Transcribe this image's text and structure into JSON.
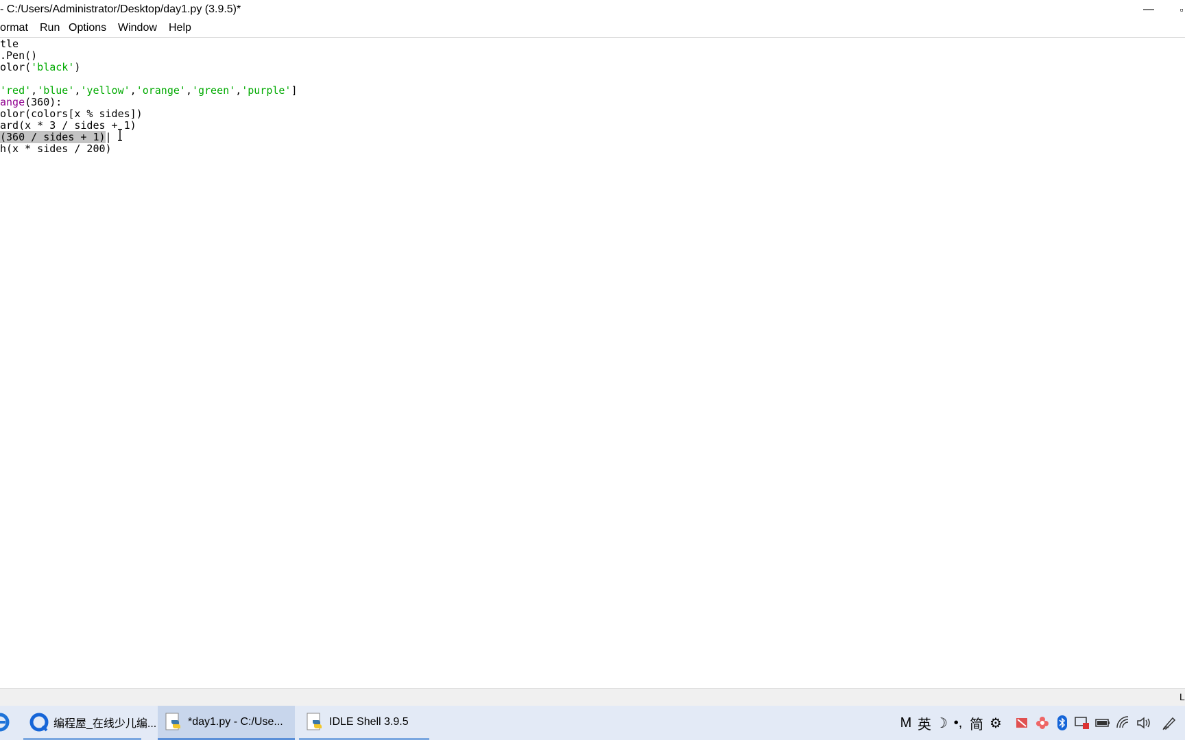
{
  "window": {
    "title": "- C:/Users/Administrator/Desktop/day1.py (3.9.5)*",
    "minimize_glyph": "—",
    "maximize_glyph": "▫"
  },
  "menubar": {
    "items": [
      {
        "label": "ormat"
      },
      {
        "label": "Run"
      },
      {
        "label": "Options"
      },
      {
        "label": "Window"
      },
      {
        "label": "Help"
      }
    ]
  },
  "editor": {
    "lines": [
      {
        "segments": [
          {
            "text": "tle",
            "kind": "plain"
          }
        ]
      },
      {
        "segments": [
          {
            "text": ".Pen()",
            "kind": "plain"
          }
        ]
      },
      {
        "segments": [
          {
            "text": "olor(",
            "kind": "plain"
          },
          {
            "text": "'black'",
            "kind": "str"
          },
          {
            "text": ")",
            "kind": "plain"
          }
        ]
      },
      {
        "segments": []
      },
      {
        "segments": [
          {
            "text": "'red'",
            "kind": "str"
          },
          {
            "text": ",",
            "kind": "plain"
          },
          {
            "text": "'blue'",
            "kind": "str"
          },
          {
            "text": ",",
            "kind": "plain"
          },
          {
            "text": "'yellow'",
            "kind": "str"
          },
          {
            "text": ",",
            "kind": "plain"
          },
          {
            "text": "'orange'",
            "kind": "str"
          },
          {
            "text": ",",
            "kind": "plain"
          },
          {
            "text": "'green'",
            "kind": "str"
          },
          {
            "text": ",",
            "kind": "plain"
          },
          {
            "text": "'purple'",
            "kind": "str"
          },
          {
            "text": "]",
            "kind": "plain"
          }
        ]
      },
      {
        "segments": [
          {
            "text": "ange",
            "kind": "builtin"
          },
          {
            "text": "(360):",
            "kind": "plain"
          }
        ]
      },
      {
        "segments": [
          {
            "text": "olor(colors[x % sides])",
            "kind": "plain"
          }
        ]
      },
      {
        "segments": [
          {
            "text": "ard(x * 3 / sides + 1)",
            "kind": "plain"
          }
        ]
      },
      {
        "segments": [
          {
            "text": "(360 / sides + 1)",
            "kind": "sel"
          },
          {
            "text": "|",
            "kind": "plain"
          }
        ]
      },
      {
        "segments": [
          {
            "text": "h(x * sides / 200)",
            "kind": "plain"
          }
        ]
      }
    ],
    "cursor_glyph": "I"
  },
  "statusbar": {
    "text": "L"
  },
  "taskbar": {
    "items": [
      {
        "label": "编程屋_在线少儿编...",
        "icon": "browser-icon",
        "active": false
      },
      {
        "label": "*day1.py - C:/Use...",
        "icon": "python-file-icon",
        "active": true
      },
      {
        "label": "IDLE Shell 3.9.5",
        "icon": "python-file-icon",
        "active": false
      }
    ],
    "tray": {
      "ime_mode": "M",
      "ime_lang": "英",
      "ime_moon": "☽",
      "ime_punct": "•,",
      "ime_simplified": "简",
      "ime_settings": "⚙"
    }
  },
  "colors": {
    "string": "#00aa00",
    "builtin": "#900090",
    "selection": "#c3c3c3",
    "taskbar": "#e3eaf6",
    "taskbar_active": "#c8d6ec"
  }
}
